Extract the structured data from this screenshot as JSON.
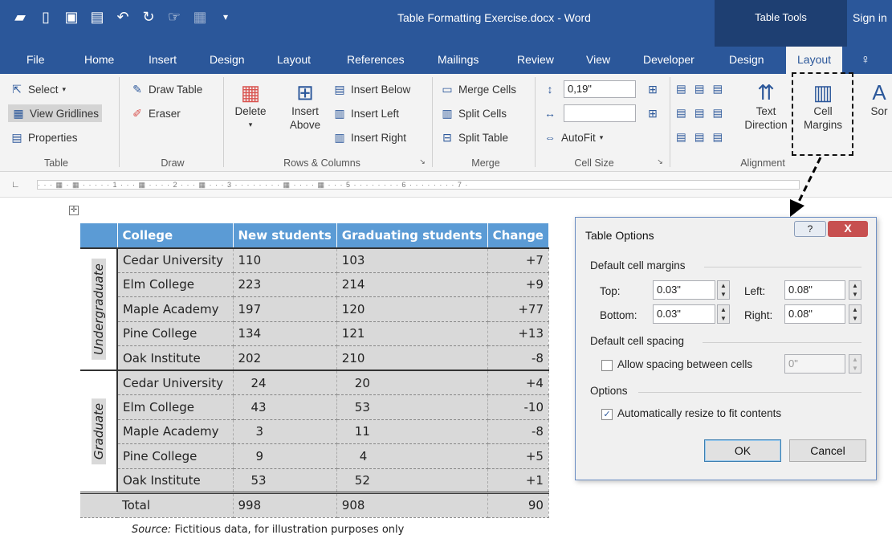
{
  "window": {
    "title": "Table Formatting Exercise.docx - Word",
    "context_tab": "Table Tools",
    "sign_in": "Sign in"
  },
  "quick_access": [
    "folder-icon",
    "new-icon",
    "save-icon",
    "save-as-icon",
    "undo-icon",
    "redo-icon",
    "touch-mode-icon",
    "print-icon",
    "customize-icon"
  ],
  "tabs": [
    "File",
    "Home",
    "Insert",
    "Design",
    "Layout",
    "References",
    "Mailings",
    "Review",
    "View",
    "Developer",
    "Design",
    "Layout"
  ],
  "tell_me_icon": "lightbulb-icon",
  "ribbon": {
    "table": {
      "select": "Select",
      "view_gridlines": "View Gridlines",
      "properties": "Properties",
      "group": "Table"
    },
    "draw": {
      "draw_table": "Draw Table",
      "eraser": "Eraser",
      "group": "Draw"
    },
    "rows_columns": {
      "delete": "Delete",
      "insert_above_1": "Insert",
      "insert_above_2": "Above",
      "insert_below": "Insert Below",
      "insert_left": "Insert Left",
      "insert_right": "Insert Right",
      "group": "Rows & Columns"
    },
    "merge": {
      "merge_cells": "Merge Cells",
      "split_cells": "Split Cells",
      "split_table": "Split Table",
      "group": "Merge"
    },
    "cell_size": {
      "height": "0,19\"",
      "width": "",
      "autofit": "AutoFit",
      "group": "Cell Size"
    },
    "alignment": {
      "text_direction_1": "Text",
      "text_direction_2": "Direction",
      "cell_margins_1": "Cell",
      "cell_margins_2": "Margins",
      "group": "Alignment"
    },
    "sort": "Sor"
  },
  "ruler": {
    "marks": "· · · ▦ · ▦ · · · · · 1 · · · ▦ · · · · 2 · · · ▦ · · · 3 · · · · · · · · ▦ · · · · ▦ · · · 5 · · · · · · · · 6 · · · · · · · · 7 ·"
  },
  "table": {
    "headers": [
      "",
      "College",
      "New students",
      "Graduating students",
      "Change"
    ],
    "groups": [
      {
        "label": "Undergraduate",
        "rows": [
          [
            "Cedar University",
            "110",
            "103",
            "+7"
          ],
          [
            "Elm College",
            "223",
            "214",
            "+9"
          ],
          [
            "Maple Academy",
            "197",
            "120",
            "+77"
          ],
          [
            "Pine College",
            "134",
            "121",
            "+13"
          ],
          [
            "Oak Institute",
            "202",
            "210",
            "-8"
          ]
        ]
      },
      {
        "label": "Graduate",
        "rows": [
          [
            "Cedar University",
            "24",
            "20",
            "+4"
          ],
          [
            "Elm College",
            "43",
            "53",
            "-10"
          ],
          [
            "Maple Academy",
            "3",
            "11",
            "-8"
          ],
          [
            "Pine College",
            "9",
            "4",
            "+5"
          ],
          [
            "Oak Institute",
            "53",
            "52",
            "+1"
          ]
        ]
      }
    ],
    "total": [
      "Total",
      "998",
      "908",
      "90"
    ]
  },
  "source": {
    "label": "Source:",
    "text": " Fictitious data, for illustration purposes only"
  },
  "dialog": {
    "title": "Table Options",
    "help": "?",
    "close": "X",
    "margins_section": "Default cell margins",
    "top_label": "Top:",
    "top": "0.03\"",
    "left_label": "Left:",
    "left": "0.08\"",
    "bottom_label": "Bottom:",
    "bottom": "0.03\"",
    "right_label": "Right:",
    "right": "0.08\"",
    "spacing_section": "Default cell spacing",
    "allow_spacing": "Allow spacing between cells",
    "spacing_value": "0\"",
    "options_section": "Options",
    "autoresize": "Automatically resize to fit contents",
    "ok": "OK",
    "cancel": "Cancel"
  }
}
